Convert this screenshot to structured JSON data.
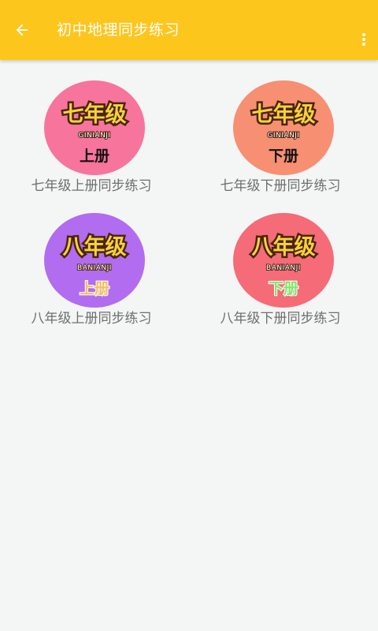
{
  "toolbar": {
    "title": "初中地理同步练习",
    "back_icon": "arrow-left-icon",
    "more_icon": "more-vertical-icon",
    "background": "#fdc61d"
  },
  "grid": {
    "items": [
      {
        "label": "七年级上册同步练习",
        "badge_grade": "七年级",
        "badge_pinyin": "GINIANJI",
        "badge_term": "上册",
        "badge_color": "#f7749d",
        "term_color": "#111111"
      },
      {
        "label": "七年级下册同步练习",
        "badge_grade": "七年级",
        "badge_pinyin": "GINIANJI",
        "badge_term": "下册",
        "badge_color": "#f78f72",
        "term_color": "#111111"
      },
      {
        "label": "八年级上册同步练习",
        "badge_grade": "八年级",
        "badge_pinyin": "BANIANJI",
        "badge_term": "上册",
        "badge_color": "#b26cf0",
        "term_color": "#f3c05a"
      },
      {
        "label": "八年级下册同步练习",
        "badge_grade": "八年级",
        "badge_pinyin": "BANIANJI",
        "badge_term": "下册",
        "badge_color": "#f56b78",
        "term_color": "#7ee86a"
      }
    ]
  }
}
